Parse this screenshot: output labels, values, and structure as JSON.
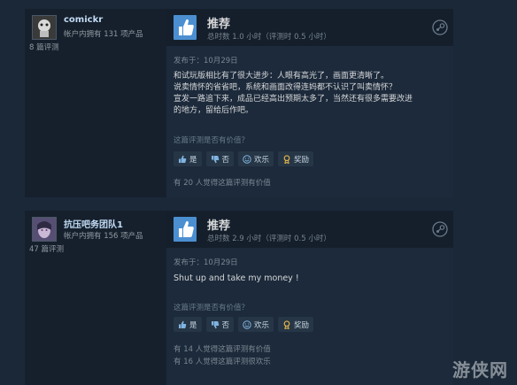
{
  "reviews": [
    {
      "username": "comickr",
      "products_owned": "帐户内拥有 131 项产品",
      "review_count": "8 篇评测",
      "verdict": "推荐",
      "hours": "总时数 1.0 小时（评测时 0.5 小时）",
      "posted": "发布于：10月29日",
      "body_lines": [
        "和试玩版相比有了很大进步：人眼有高光了，画面更清晰了。",
        "说卖情怀的省省吧，系统和画面改得连妈都不认识了叫卖情怀？",
        "宣发一路追下来，成品已经高出预期太多了，当然还有很多需要改进",
        "的地方，留给后作吧。"
      ],
      "helpful_question": "这篇评测是否有价值？",
      "buttons": {
        "yes": "是",
        "no": "否",
        "funny": "欢乐",
        "award": "奖励"
      },
      "stats": [
        "有 20 人觉得这篇评测有价值"
      ]
    },
    {
      "username": "抗压吧务团队1",
      "products_owned": "帐户内拥有 156 项产品",
      "review_count": "47 篇评测",
      "verdict": "推荐",
      "hours": "总时数 2.9 小时（评测时 0.5 小时）",
      "posted": "发布于：10月29日",
      "body_lines": [
        "Shut up and take my money !"
      ],
      "helpful_question": "这篇评测是否有价值？",
      "buttons": {
        "yes": "是",
        "no": "否",
        "funny": "欢乐",
        "award": "奖励"
      },
      "stats": [
        "有 14 人觉得这篇评测有价值",
        "有 16 人觉得这篇评测很欢乐"
      ]
    }
  ],
  "watermark": "游侠网",
  "colors": {
    "background": "#1b2838",
    "thumb": "#4b8fd1",
    "username": "#c1dbf4"
  }
}
